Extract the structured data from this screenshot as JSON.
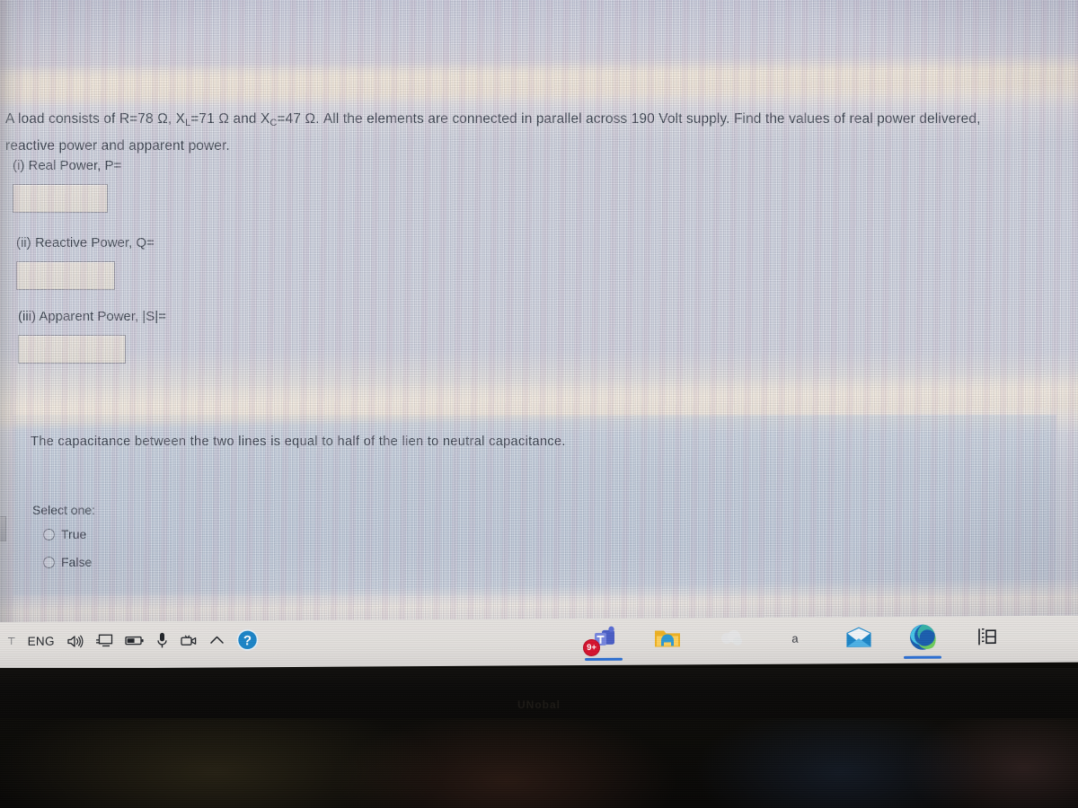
{
  "quiz": {
    "question1": {
      "statement_line1": "A load consists of R=78 Ω, X",
      "statement_sub1": "L",
      "statement_line1b": "=71 Ω and X",
      "statement_sub2": "C",
      "statement_line1c": "=47 Ω. All the elements are connected in parallel across 190 Volt supply. Find the values of real power delivered,",
      "statement_line2": "reactive power and apparent power.",
      "fields": [
        {
          "label": "(i) Real Power, P=",
          "value": "",
          "placeholder": ""
        },
        {
          "label": "(ii) Reactive Power, Q=",
          "value": "",
          "placeholder": ""
        },
        {
          "label": "(iii) Apparent Power, |S|=",
          "value": "",
          "placeholder": ""
        }
      ]
    },
    "question2": {
      "statement": "The  capacitance  between the  two lines is equal to  half of the lien to neutral capacitance.",
      "select_prompt": "Select one:",
      "options": [
        {
          "label": "True",
          "selected": false
        },
        {
          "label": "False",
          "selected": false
        }
      ]
    }
  },
  "taskbar": {
    "language": "ENG",
    "tray_icons": [
      "speaker-icon",
      "network-monitor-icon",
      "battery-icon",
      "microphone-icon",
      "camera-icon",
      "chevron-up-icon",
      "help-icon"
    ],
    "apps": [
      {
        "name": "microsoft-teams",
        "badge": "9+",
        "active": true
      },
      {
        "name": "file-explorer",
        "badge": "",
        "active": false
      },
      {
        "name": "cloud-app",
        "badge": "",
        "active": false
      },
      {
        "name": "a-app",
        "label": "a",
        "badge": "",
        "active": false
      },
      {
        "name": "mail",
        "badge": "",
        "active": false
      },
      {
        "name": "microsoft-edge",
        "badge": "",
        "active": true
      },
      {
        "name": "display-zoom",
        "badge": "",
        "active": false
      }
    ]
  },
  "monitor": {
    "bezel_logo": "UNobal"
  },
  "colors": {
    "screen_bg": "#cdd2dd",
    "card_bg": "#b0c4d6",
    "input_bg": "#ece6dc",
    "text": "#1d2733",
    "accent": "#2b6fd4",
    "badge": "#d8132f"
  }
}
